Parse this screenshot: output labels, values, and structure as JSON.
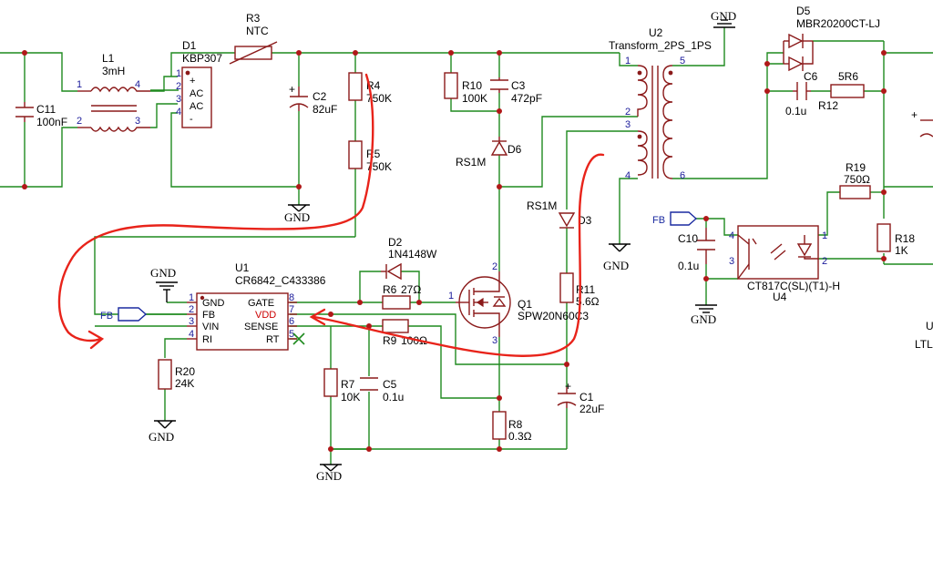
{
  "labels": {
    "l1_ref": "L1",
    "l1_val": "3mH",
    "c11_ref": "C11",
    "c11_val": "100nF",
    "d1_ref": "D1",
    "d1_val": "KBP307",
    "r3_ref": "R3",
    "r3_val": "NTC",
    "c2_ref": "C2",
    "c2_val": "82uF",
    "r4_ref": "R4",
    "r4_val": "750K",
    "r5_ref": "R5",
    "r5_val": "750K",
    "r10_ref": "R10",
    "r10_val": "100K",
    "c3_ref": "C3",
    "c3_val": "472pF",
    "d6_ref": "D6",
    "d6_val": "RS1M",
    "u2_ref": "U2",
    "u2_val": "Transform_2PS_1PS",
    "d5_ref": "D5",
    "d5_val": "MBR20200CT-LJ",
    "c6_ref": "C6",
    "c6_val": "0.1u",
    "r12_ref": "R12",
    "r12_val": "5R6",
    "r19_ref": "R19",
    "r19_val": "750Ω",
    "r18_ref": "R18",
    "r18_val": "1K",
    "c10_ref": "C10",
    "c10_val": "0.1u",
    "u4_ref": "U4",
    "u4_val": "CT817C(SL)(T1)-H",
    "d3_ref": "D3",
    "d3_val": "RS1M",
    "r11_ref": "R11",
    "r11_val": "5.6Ω",
    "c1_ref": "C1",
    "c1_val": "22uF",
    "r8_ref": "R8",
    "r8_val": "0.3Ω",
    "q1_ref": "Q1",
    "q1_val": "SPW20N60C3",
    "d2_ref": "D2",
    "d2_val": "1N4148W",
    "r6_ref": "R6",
    "r6_val": "27Ω",
    "r9_ref": "R9",
    "r9_val": "100Ω",
    "r7_ref": "R7",
    "r7_val": "10K",
    "c5_ref": "C5",
    "c5_val": "0.1u",
    "u1_ref": "U1",
    "u1_val": "CR6842_C433386",
    "r20_ref": "R20",
    "r20_val": "24K",
    "ltl_partial": "LTL",
    "u_partial": "U"
  },
  "u1_pins": {
    "gnd": "GND",
    "fb": "FB",
    "vin": "VIN",
    "ri": "RI",
    "gate": "GATE",
    "vdd": "VDD",
    "sense": "SENSE",
    "rt": "RT"
  },
  "d1_pins": {
    "plus": "+",
    "ac1": "AC",
    "ac2": "AC",
    "minus": "-"
  },
  "pin_numbers": {
    "one": "1",
    "two": "2",
    "three": "3",
    "four": "4",
    "five": "5",
    "six": "6",
    "seven": "7",
    "eight": "8"
  },
  "net_labels": {
    "gnd": "GND",
    "fb": "FB"
  },
  "colors": {
    "wire": "#1f8a1f",
    "component": "#8b1a1a",
    "pin_number": "#1a1a9a",
    "annotation": "#e8231a",
    "net_flag": "#1a2aa0",
    "vdd_label": "#cc0000"
  }
}
